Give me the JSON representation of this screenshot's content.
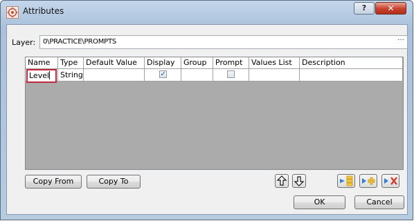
{
  "window": {
    "title": "Attributes",
    "help_label": "?",
    "close_label": "✕"
  },
  "layer": {
    "label": "Layer:",
    "value": "0\\PRACTICE\\PROMPTS",
    "browse_label": "···"
  },
  "grid": {
    "columns": [
      "Name",
      "Type",
      "Default Value",
      "Display",
      "Group",
      "Prompt",
      "Values List",
      "Description"
    ],
    "rows": [
      {
        "name": "Level",
        "type": "String",
        "default_value": "",
        "display": true,
        "group": "",
        "prompt": false,
        "values_list": "",
        "description": ""
      }
    ]
  },
  "buttons": {
    "copy_from": "Copy From",
    "copy_to": "Copy To",
    "ok": "OK",
    "cancel": "Cancel"
  },
  "icons": [
    "attributes-app-icon",
    "move-up-icon",
    "move-down-icon",
    "insert-row-icon",
    "add-row-icon",
    "delete-row-icon"
  ],
  "colors": {
    "highlight_border": "#c0283b",
    "close_button": "#c7402b",
    "grid_empty_area": "#ababab"
  }
}
